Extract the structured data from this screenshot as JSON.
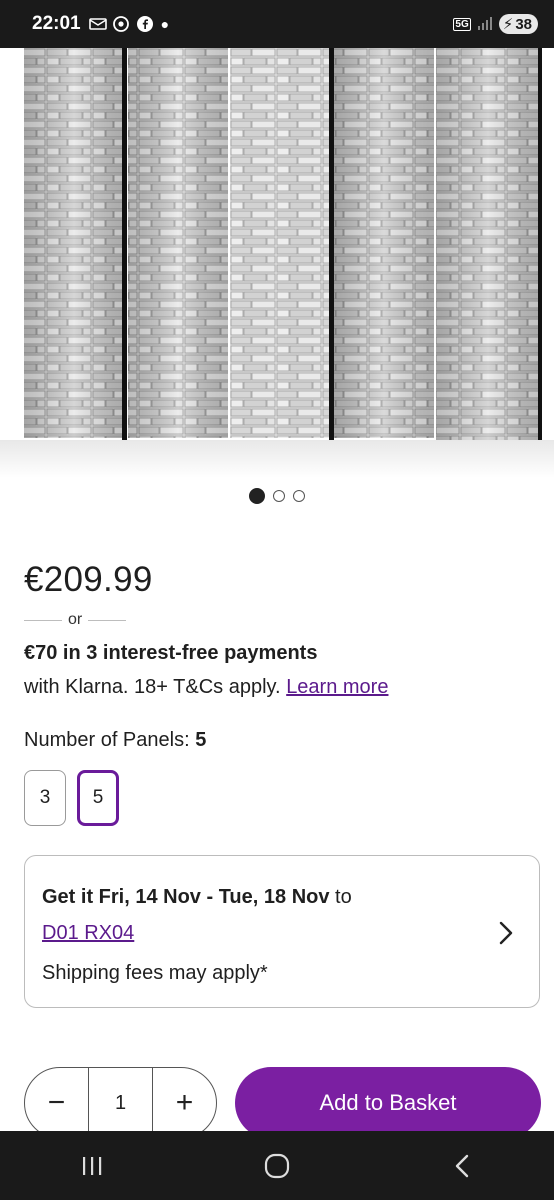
{
  "status_bar": {
    "time": "22:01",
    "network": "5G",
    "battery": "38",
    "icons": [
      "notification-icon",
      "chrome-icon",
      "facebook-icon",
      "dot-icon",
      "signal-icon"
    ]
  },
  "gallery": {
    "image_alt": "Five-panel room divider with white stone wall print",
    "pages": 3,
    "active_page": 1
  },
  "price": {
    "amount": "€209.99",
    "or": "or",
    "klarna_line1": "€70 in 3 interest-free payments",
    "klarna_line2": "with Klarna. 18+ T&Cs apply.",
    "learn_more": "Learn more"
  },
  "panels": {
    "label": "Number of Panels:",
    "selected": "5",
    "options": [
      "3",
      "5"
    ]
  },
  "delivery": {
    "prefix": "Get it ",
    "dates": "Fri, 14 Nov - Tue, 18 Nov",
    "suffix": " to",
    "postcode": "D01 RX04",
    "fees_note": "Shipping fees may apply*"
  },
  "purchase": {
    "minus": "−",
    "quantity": "1",
    "plus": "+",
    "add_label": "Add to Basket"
  },
  "colors": {
    "accent": "#7b1fa2",
    "link": "#5b1a8c",
    "status_bar": "#1a1a1a"
  }
}
